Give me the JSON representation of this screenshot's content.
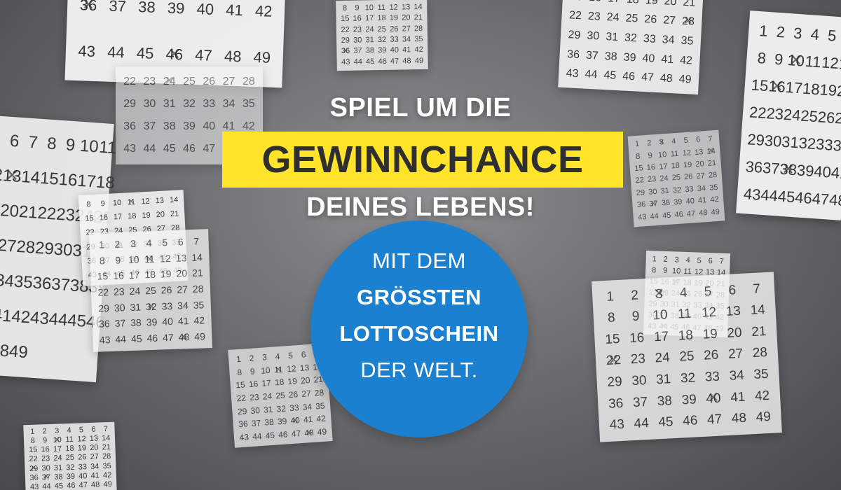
{
  "headline": {
    "line1": "SPIEL UM DIE",
    "line2": "GEWINNCHANCE",
    "line3": "DEINES LEBENS!"
  },
  "circle": {
    "line1": "MIT DEM",
    "line2": "GRÖSSTEN",
    "line3": "LOTTOSCHEIN",
    "line4": "DER WELT."
  },
  "colors": {
    "highlight_bar": "#ffe42a",
    "circle_fill": "#1c80d0",
    "background": "#6e6e72",
    "text_light": "#ffffff",
    "text_dark": "#2f2f2f"
  },
  "tickets": [
    {
      "start": 36,
      "count": 14,
      "marks": [
        36,
        46
      ]
    },
    {
      "start": 8,
      "count": 42,
      "marks": [
        36
      ]
    },
    {
      "start": 15,
      "count": 35,
      "marks": [
        28
      ]
    },
    {
      "start": 22,
      "count": 28,
      "marks": [
        24
      ]
    },
    {
      "start": 1,
      "count": 49,
      "marks": [
        10,
        16,
        38
      ]
    },
    {
      "start": 5,
      "count": 45,
      "marks": [
        13,
        40
      ]
    },
    {
      "start": 8,
      "count": 42,
      "marks": [
        11,
        31,
        47
      ]
    },
    {
      "start": 1,
      "count": 49,
      "marks": [
        11,
        32,
        48
      ]
    },
    {
      "start": 1,
      "count": 49,
      "marks": [
        3,
        14,
        37
      ]
    },
    {
      "start": 1,
      "count": 49,
      "marks": [
        17,
        23,
        44
      ]
    },
    {
      "start": 1,
      "count": 49,
      "marks": [
        3,
        22,
        40
      ]
    },
    {
      "start": 1,
      "count": 49,
      "marks": [
        11,
        40,
        48
      ]
    },
    {
      "start": 1,
      "count": 49,
      "marks": [
        10,
        29,
        37
      ]
    }
  ]
}
